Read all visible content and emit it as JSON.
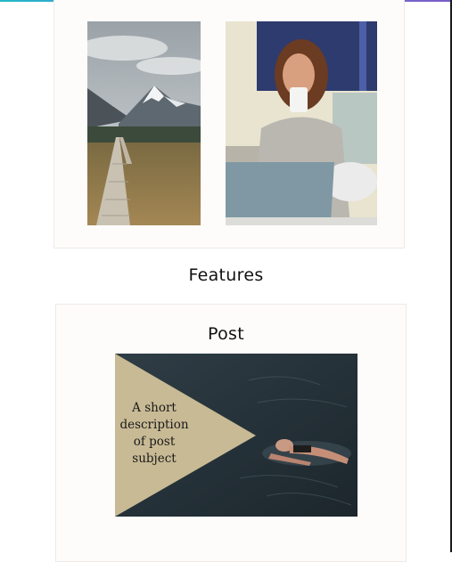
{
  "sections": {
    "features_heading": "Features",
    "post": {
      "title": "Post",
      "overlay_text": "A short description of post subject"
    }
  },
  "images": {
    "mountain": "mountain-boardwalk-photo",
    "woman": "woman-with-laptop-and-coffee-photo",
    "swimmer": "person-floating-in-water-photo"
  },
  "colors": {
    "overlay_triangle": "#d6c69c",
    "card_background": "#fefcfb"
  }
}
